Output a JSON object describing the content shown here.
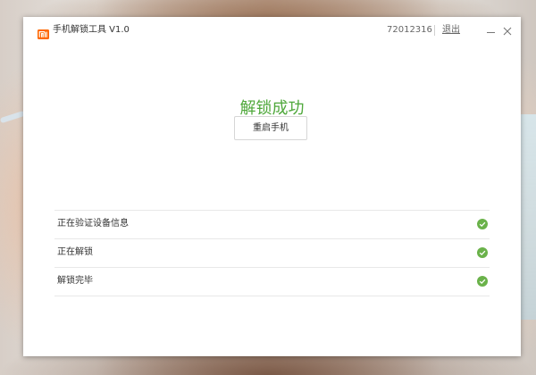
{
  "window": {
    "app_title": "手机解锁工具 V1.0",
    "account_id": "72012316",
    "logout_label": "退出"
  },
  "main": {
    "status_title": "解锁成功",
    "reboot_button_label": "重启手机",
    "steps": [
      {
        "label": "正在验证设备信息",
        "status_icon": "check-circle-icon"
      },
      {
        "label": "正在解锁",
        "status_icon": "check-circle-icon"
      },
      {
        "label": "解锁完毕",
        "status_icon": "check-circle-icon"
      }
    ]
  },
  "colors": {
    "brand_accent": "#ff6700",
    "success": "#4fa83b",
    "check_icon": "#6ab24a"
  },
  "icons": {
    "logo": "mi-logo-icon",
    "minimize": "minimize-icon",
    "close": "close-icon"
  }
}
